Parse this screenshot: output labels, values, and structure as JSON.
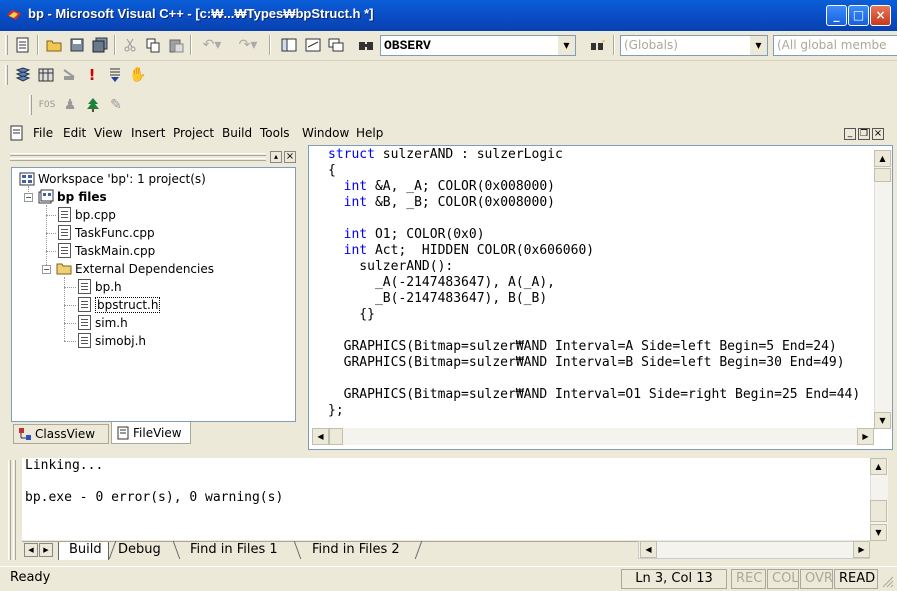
{
  "window": {
    "title": "bp - Microsoft Visual C++ - [c:₩...₩Types₩bpStruct.h *]",
    "min": "_",
    "max": "□",
    "close": "×"
  },
  "toolbar": {
    "config_combo": "OBSERV",
    "globals_combo": "(Globals)",
    "members_combo": "(All global membe"
  },
  "menu": [
    "File",
    "Edit",
    "View",
    "Insert",
    "Project",
    "Build",
    "Tools",
    "Window",
    "Help"
  ],
  "workspace": {
    "root": "Workspace 'bp': 1 project(s)",
    "project": "bp files",
    "files": [
      "bp.cpp",
      "TaskFunc.cpp",
      "TaskMain.cpp"
    ],
    "deps_folder": "External Dependencies",
    "deps": [
      "bp.h",
      "bpstruct.h",
      "sim.h",
      "simobj.h"
    ],
    "tabs": [
      "ClassView",
      "FileView"
    ]
  },
  "editor": {
    "lines": [
      "struct sulzerAND : sulzerLogic",
      "{",
      "  int &A, _A; COLOR(0x008000)",
      "  int &B, _B; COLOR(0x008000)",
      "",
      "  int O1; COLOR(0x0)",
      "  int Act;  HIDDEN COLOR(0x606060)",
      "    sulzerAND():",
      "      _A(-2147483647), A(_A),",
      "      _B(-2147483647), B(_B)",
      "    {}",
      "",
      "  GRAPHICS(Bitmap=sulzer₩AND Interval=A Side=left Begin=5 End=24)",
      "  GRAPHICS(Bitmap=sulzer₩AND Interval=B Side=left Begin=30 End=49)",
      "",
      "  GRAPHICS(Bitmap=sulzer₩AND Interval=O1 Side=right Begin=25 End=44)",
      "};"
    ]
  },
  "output": {
    "lines": [
      "Linking...",
      "",
      "bp.exe - 0 error(s), 0 warning(s)"
    ],
    "tabs": [
      "Build",
      "Debug",
      "Find in Files 1",
      "Find in Files 2"
    ]
  },
  "status": {
    "message": "Ready",
    "position": "Ln 3, Col 13",
    "rec": "REC",
    "col": "COL",
    "ovr": "OVR",
    "read": "READ"
  }
}
